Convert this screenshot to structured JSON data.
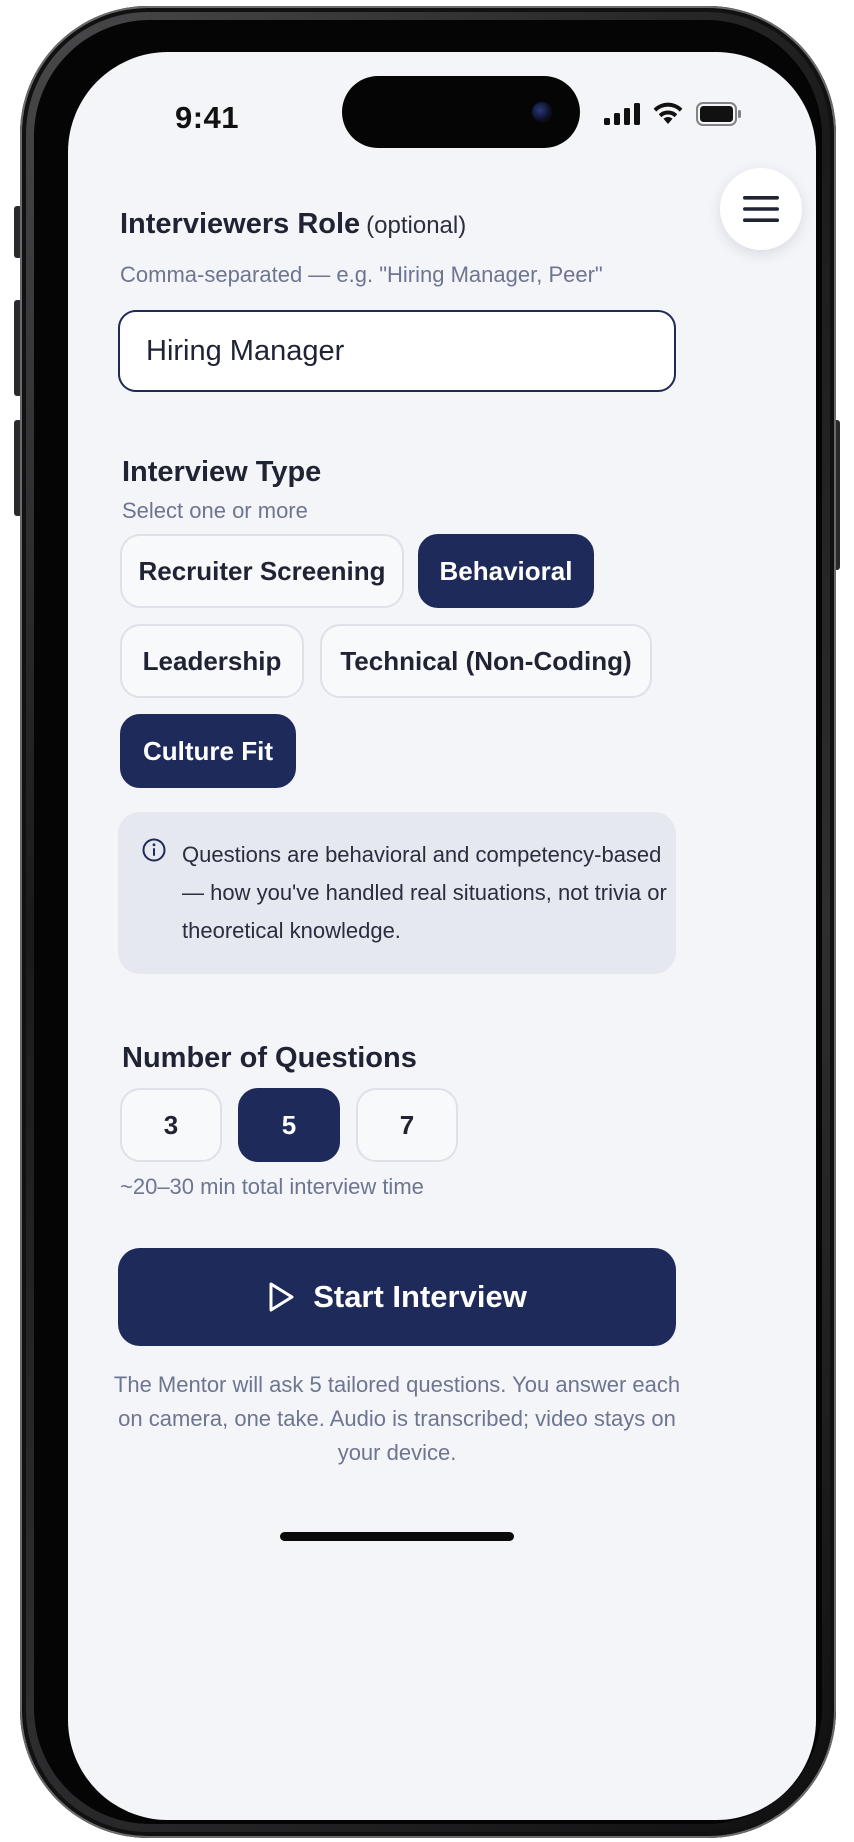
{
  "status_bar": {
    "time": "9:41",
    "signal_icon": "cellular-signal-icon",
    "wifi_icon": "wifi-icon",
    "battery_icon": "battery-icon"
  },
  "header": {
    "menu_icon": "hamburger-menu-icon"
  },
  "interviewer_role": {
    "label": "Interviewers Role",
    "optional_tag": "(optional)",
    "hint": "Comma-separated — e.g. \"Hiring Manager, Peer\"",
    "value": "Hiring Manager"
  },
  "interview_type": {
    "label": "Interview Type",
    "hint": "Select one or more",
    "options": [
      {
        "label": "Recruiter Screening",
        "selected": false
      },
      {
        "label": "Behavioral",
        "selected": true
      },
      {
        "label": "Leadership",
        "selected": false
      },
      {
        "label": "Technical (Non-Coding)",
        "selected": false
      },
      {
        "label": "Culture Fit",
        "selected": true
      }
    ],
    "info_icon": "info-circle-icon",
    "info_text": "Questions are behavioral and competency-based — how you've handled real situations, not trivia or theoretical knowledge."
  },
  "question_count": {
    "label": "Number of Questions",
    "options": [
      {
        "label": "3",
        "selected": false
      },
      {
        "label": "5",
        "selected": true
      },
      {
        "label": "7",
        "selected": false
      }
    ],
    "hint": "~20–30 min total interview time"
  },
  "start_button": {
    "icon": "play-icon",
    "label": "Start Interview"
  },
  "footer_note": "The Mentor will ask 5 tailored questions. You answer each on camera, one take. Audio is transcribed; video stays on your device.",
  "colors": {
    "primary": "#1e2a5a",
    "screen_background": "#f4f5f9",
    "muted_text": "#6e7590"
  }
}
